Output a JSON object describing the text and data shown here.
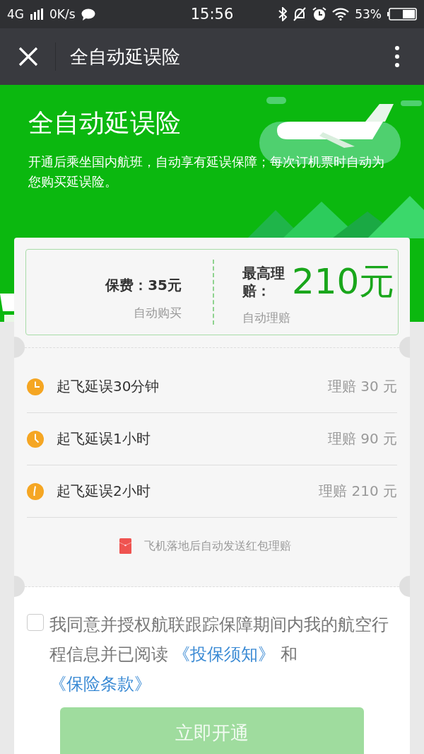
{
  "status_bar": {
    "network": "4G",
    "speed": "0K/s",
    "time": "15:56",
    "battery": "53%"
  },
  "nav": {
    "title": "全自动延误险"
  },
  "hero": {
    "title": "全自动延误险",
    "description": "开通后乘坐国内航班，自动享有延误保障；每次订机票时自动为您购买延误险。"
  },
  "summary": {
    "premium": "保费：35元",
    "premium_note": "自动购买",
    "max_label": "最高理赔：",
    "max_amount": "210元",
    "max_note": "自动理赔"
  },
  "tiers": [
    {
      "condition": "起飞延误30分钟",
      "payout": "理赔 30 元"
    },
    {
      "condition": "起飞延误1小时",
      "payout": "理赔 90 元"
    },
    {
      "condition": "起飞延误2小时",
      "payout": "理赔 210 元"
    }
  ],
  "red_packet_note": "飞机落地后自动发送红包理赔",
  "agreement": {
    "checked": false,
    "parts": [
      {
        "kind": "text",
        "text": "我同意并授权航联跟踪保障期间内我的航空行程信息并已阅读 "
      },
      {
        "kind": "link",
        "text": "《投保须知》"
      },
      {
        "kind": "text",
        "text": " 和 "
      },
      {
        "kind": "link",
        "text": "《保险条款》"
      }
    ]
  },
  "activate_button": {
    "label": "立即开通",
    "disabled": true
  }
}
